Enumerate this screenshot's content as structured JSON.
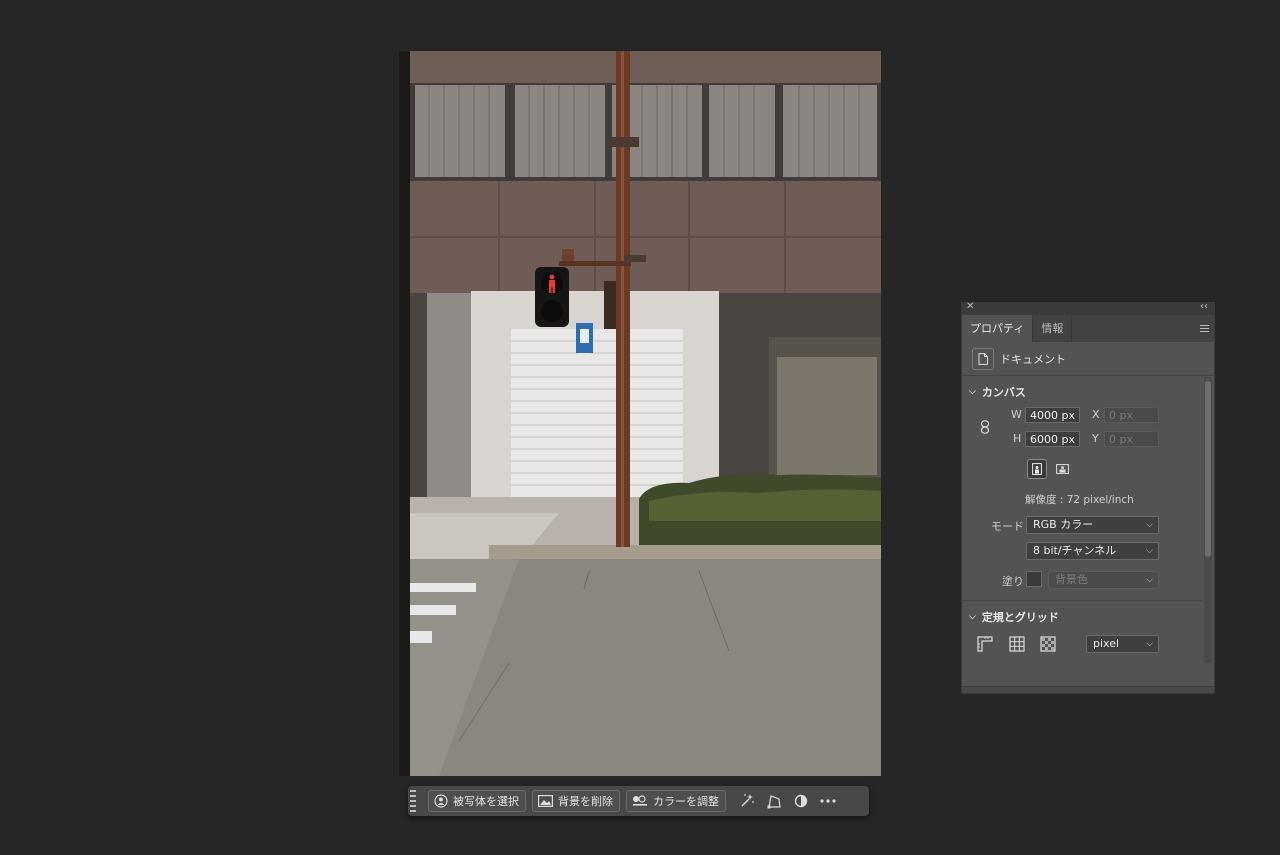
{
  "taskbar": {
    "select_subject": "被写体を選択",
    "remove_background": "背景を削除",
    "adjust_color": "カラーを調整",
    "icons": [
      "grip-handle-icon",
      "magic-wand-icon",
      "transform-icon",
      "adjustment-circle-icon",
      "more-icon"
    ]
  },
  "panel": {
    "tabs": [
      "プロパティ",
      "情報"
    ],
    "active_tab": "プロパティ",
    "doc_label": "ドキュメント",
    "canvas": {
      "title": "カンバス",
      "w_label": "W",
      "w_value": "4000 px",
      "h_label": "H",
      "h_value": "6000 px",
      "x_label": "X",
      "x_placeholder": "0 px",
      "y_label": "Y",
      "y_placeholder": "0 px",
      "resolution": "解像度 : 72 pixel/inch",
      "mode_label": "モード",
      "mode_value": "RGB カラー",
      "bit_depth": "8 bit/チャンネル",
      "fill_label": "塗り",
      "fill_value": "背景色"
    },
    "rulers": {
      "title": "定規とグリッド",
      "unit": "pixel"
    }
  },
  "colors": {
    "app_bg": "#262626",
    "panel_bg": "#535353",
    "taskbar_bg": "#484848",
    "signal_red": "#e5393f"
  }
}
